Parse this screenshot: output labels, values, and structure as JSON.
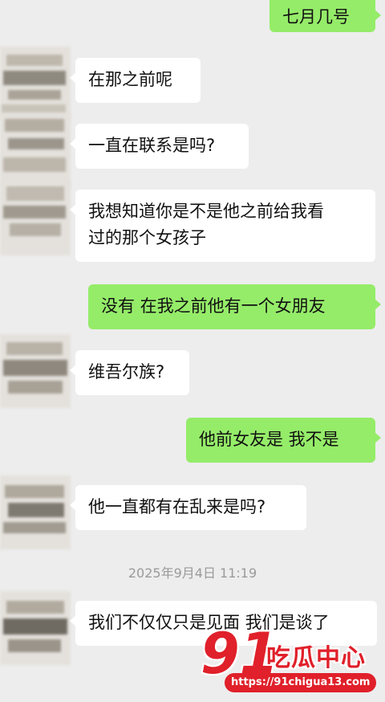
{
  "messages": [
    {
      "side": "out",
      "text": "七月几号"
    },
    {
      "side": "in",
      "text": "在那之前呢"
    },
    {
      "side": "in",
      "text": "一直在联系是吗?"
    },
    {
      "side": "in",
      "text": "我想知道你是不是他之前给我看\n过的那个女孩子"
    },
    {
      "side": "out",
      "text": "没有 在我之前他有一个女朋友"
    },
    {
      "side": "in",
      "text": "维吾尔族?"
    },
    {
      "side": "out",
      "text": "他前女友是 我不是"
    },
    {
      "side": "in",
      "text": "他一直都有在乱来是吗?"
    },
    {
      "side": "in",
      "text": "我们不仅仅只是见面 我们是谈了"
    }
  ],
  "timestamp": "2025年9月4日 11:19",
  "watermark": {
    "number": "91",
    "name": "吃瓜中心",
    "url": "https://91chigua13.com"
  },
  "colors": {
    "background": "#ededed",
    "incoming_bubble": "#ffffff",
    "outgoing_bubble": "#95ec69",
    "watermark": "#e0202a"
  }
}
